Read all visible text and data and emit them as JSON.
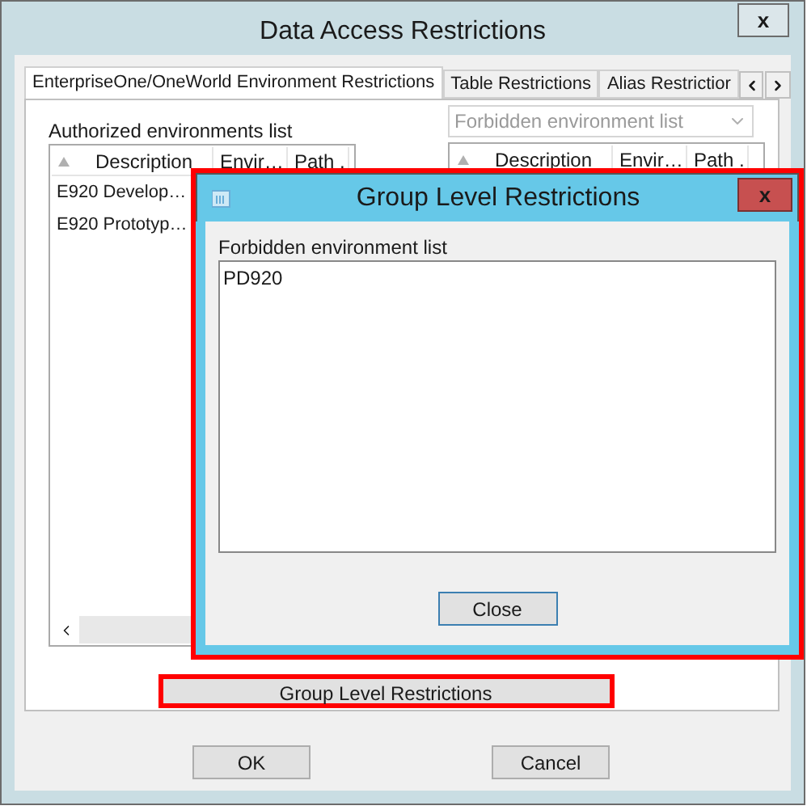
{
  "window": {
    "title": "Data Access Restrictions",
    "close": "x"
  },
  "tabs": [
    {
      "label": "EnterpriseOne/OneWorld Environment Restrictions",
      "selected": true
    },
    {
      "label": "Table Restrictions",
      "selected": false
    },
    {
      "label": "Alias Restrictior",
      "selected": false
    }
  ],
  "authorized_list": {
    "label": "Authorized environments list",
    "columns": [
      "Description",
      "Envir…",
      "Path ."
    ],
    "rows": [
      "E920 Develop…",
      "E920 Prototyp…"
    ]
  },
  "forbidden_list": {
    "dropdown": {
      "placeholder": "Forbidden environment list",
      "disabled": true
    },
    "columns": [
      "Description",
      "Envir…",
      "Path ."
    ]
  },
  "group_button": {
    "label": "Group Level Restrictions",
    "highlighted": true
  },
  "buttons": [
    "OK",
    "Cancel"
  ],
  "dialog": {
    "title": "Group Level Restrictions",
    "close": "x",
    "highlighted": true,
    "label": "Forbidden environment list",
    "items": [
      "PD920"
    ],
    "button": "Close"
  }
}
